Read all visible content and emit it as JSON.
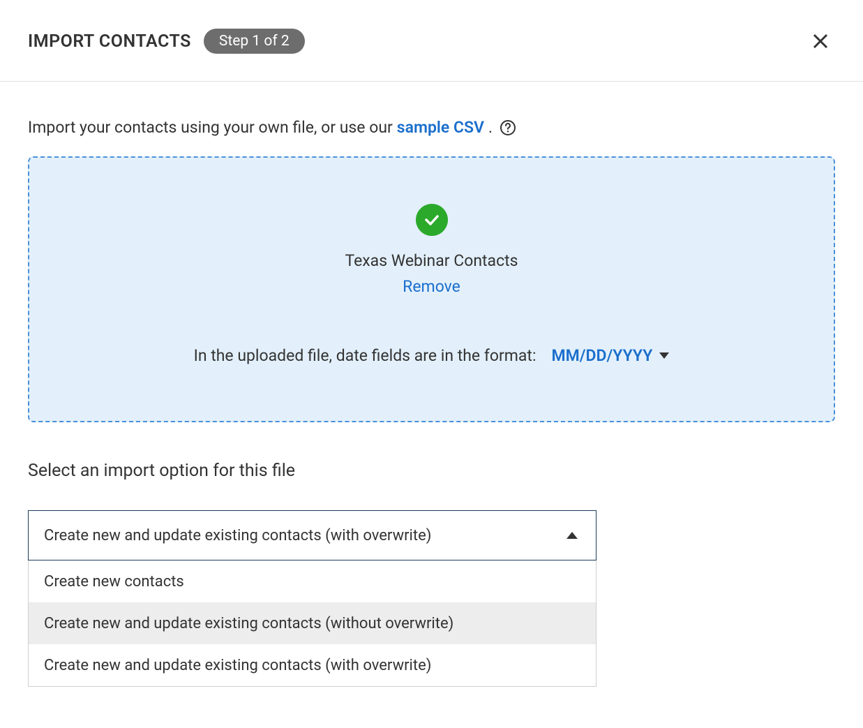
{
  "header": {
    "title": "IMPORT CONTACTS",
    "step_label": "Step 1 of 2"
  },
  "intro": {
    "prefix": "Import your contacts using your own file, or use our ",
    "link_text": "sample CSV",
    "suffix": "."
  },
  "upload": {
    "file_name": "Texas Webinar Contacts",
    "remove_label": "Remove",
    "date_format_label": "In the uploaded file, date fields are in the format:",
    "date_format_value": "MM/DD/YYYY"
  },
  "import_option": {
    "section_label": "Select an import option for this file",
    "selected": "Create new and update existing contacts (with overwrite)",
    "options": [
      {
        "label": "Create new contacts",
        "highlighted": false
      },
      {
        "label": "Create new and update existing contacts (without overwrite)",
        "highlighted": true
      },
      {
        "label": "Create new and update existing contacts (with overwrite)",
        "highlighted": false
      }
    ]
  }
}
